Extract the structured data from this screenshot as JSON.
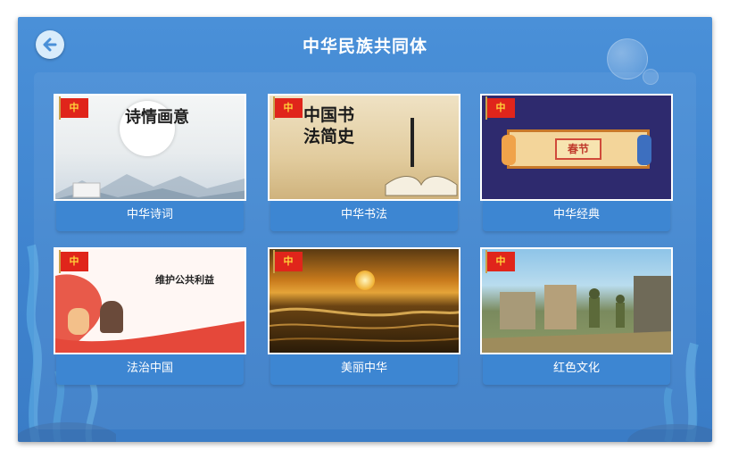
{
  "header": {
    "title": "中华民族共同体"
  },
  "icons": {
    "back": "arrow-left-icon"
  },
  "cards": [
    {
      "label": "中华诗词",
      "flag": "中",
      "thumb_text": "诗情画意"
    },
    {
      "label": "中华书法",
      "flag": "中",
      "thumb_text": "中国书法简史"
    },
    {
      "label": "中华经典",
      "flag": "中",
      "thumb_text": "春节"
    },
    {
      "label": "法治中国",
      "flag": "中",
      "thumb_text": "维护公共利益"
    },
    {
      "label": "美丽中华",
      "flag": "中",
      "thumb_text": ""
    },
    {
      "label": "红色文化",
      "flag": "中",
      "thumb_text": ""
    }
  ],
  "colors": {
    "background": "#4a90d8",
    "card_label": "#3d86d2",
    "flag": "#e0251b"
  }
}
